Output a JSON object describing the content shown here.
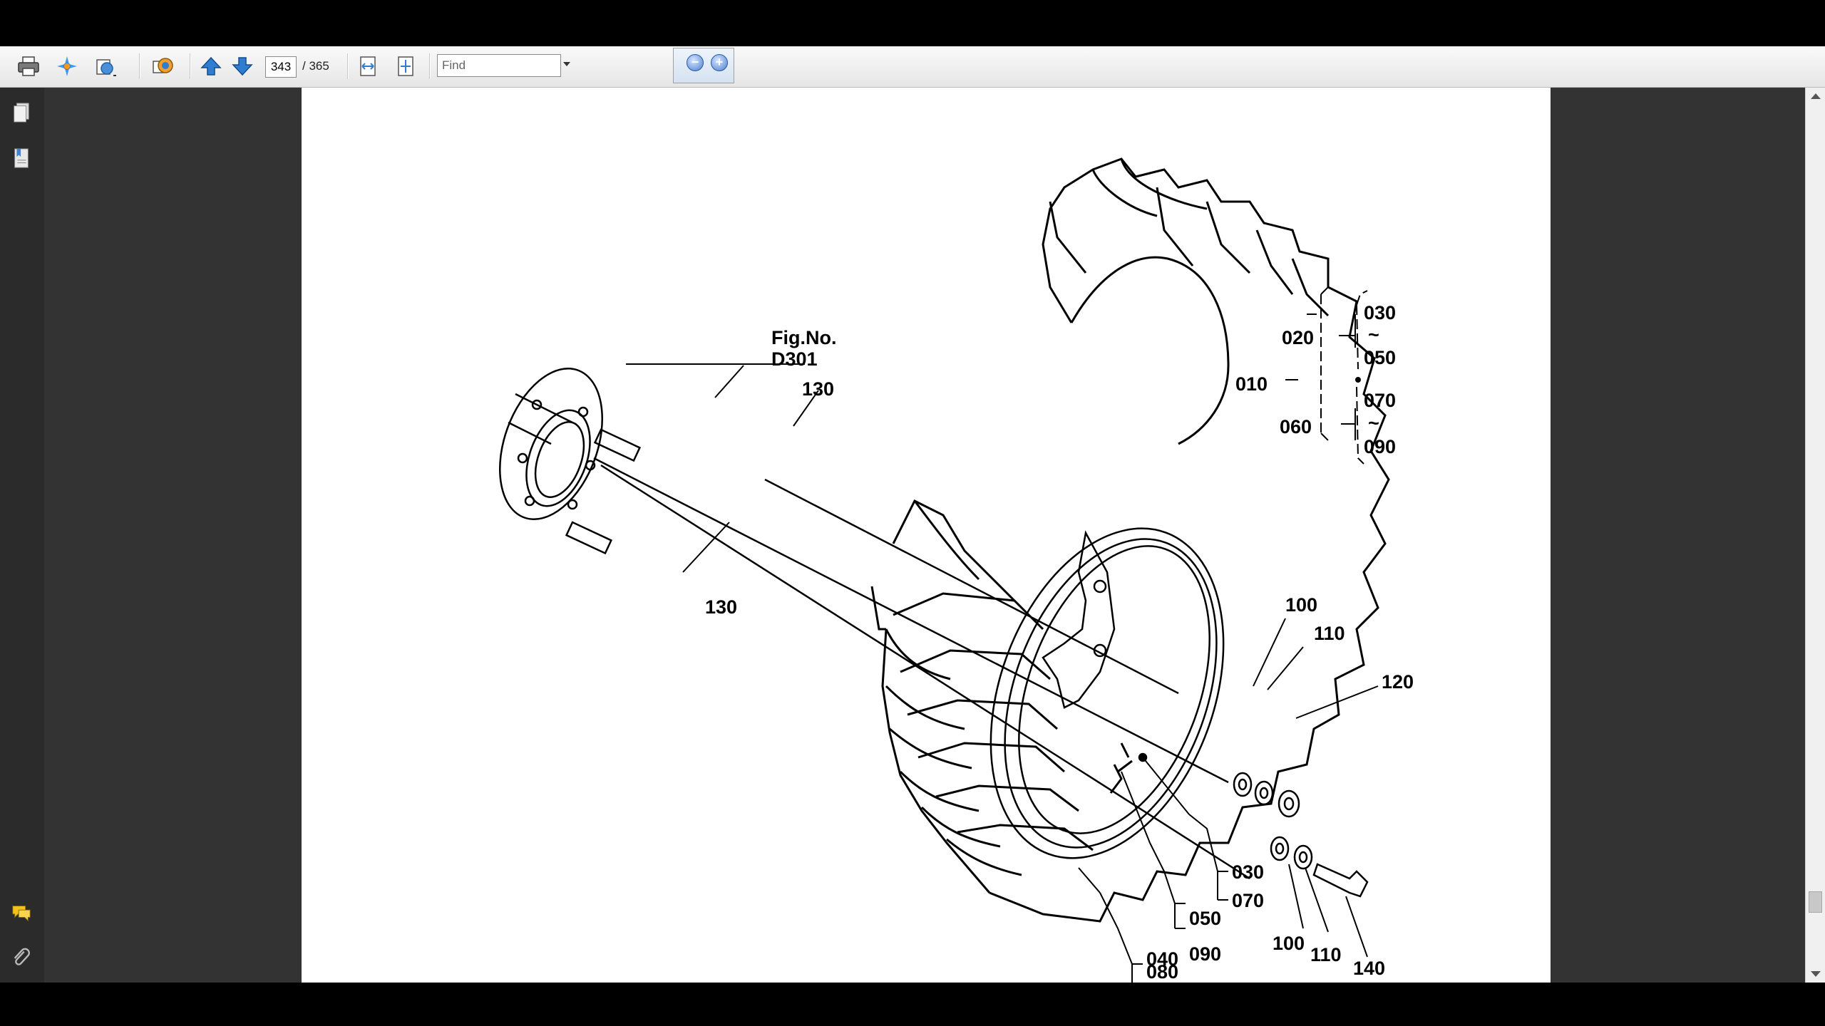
{
  "toolbar": {
    "current_page": "343",
    "total_pages": "/ 365",
    "find_placeholder": "Find",
    "zoom_out": "−",
    "zoom_in": "+"
  },
  "icons": [
    "print-icon",
    "sign-icon",
    "export-icon",
    "share-icon",
    "page-up-icon",
    "page-down-icon",
    "fit-width-icon",
    "fit-page-icon",
    "pages-panel-icon",
    "bookmarks-icon",
    "comments-icon",
    "attachments-icon"
  ],
  "drawing": {
    "figure_label": "Fig.No.",
    "figure_number": "D301",
    "labels": {
      "l010": "010",
      "l020": "020",
      "l060": "060",
      "t030": "030",
      "t050": "050",
      "t070": "070",
      "t090": "090",
      "tilde": "~",
      "s130a": "130",
      "s130b": "130",
      "w100a": "100",
      "w110a": "110",
      "n120": "120",
      "w100b": "100",
      "w110b": "110",
      "b140": "140",
      "c030": "030",
      "c070": "070",
      "c050": "050",
      "c090": "090",
      "c040": "040",
      "c080": "080"
    }
  }
}
